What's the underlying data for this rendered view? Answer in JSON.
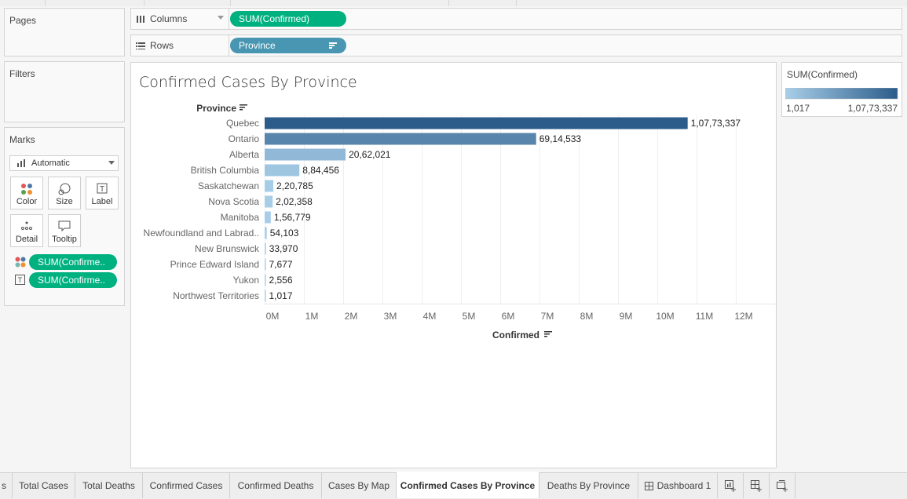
{
  "sidebar": {
    "pages_title": "Pages",
    "filters_title": "Filters",
    "marks_title": "Marks",
    "mark_type": "Automatic",
    "mark_buttons": {
      "color": "Color",
      "size": "Size",
      "label": "Label",
      "detail": "Detail",
      "tooltip": "Tooltip"
    },
    "mark_pills": [
      "SUM(Confirme..",
      "SUM(Confirme.."
    ]
  },
  "shelves": {
    "columns_label": "Columns",
    "columns_pill": "SUM(Confirmed)",
    "rows_label": "Rows",
    "rows_pill": "Province"
  },
  "view": {
    "title": "Confirmed Cases By Province"
  },
  "legend": {
    "title": "SUM(Confirmed)",
    "min_label": "1,017",
    "max_label": "1,07,73,337",
    "color_low": "#a9cfe9",
    "color_high": "#2b5c8a"
  },
  "chart_data": {
    "type": "bar",
    "orientation": "horizontal",
    "row_header": "Province",
    "xlabel": "Confirmed",
    "xlim": [
      0,
      12800000
    ],
    "x_ticks": [
      "0M",
      "1M",
      "2M",
      "3M",
      "4M",
      "5M",
      "6M",
      "7M",
      "8M",
      "9M",
      "10M",
      "11M",
      "12M"
    ],
    "categories": [
      "Quebec",
      "Ontario",
      "Alberta",
      "British Columbia",
      "Saskatchewan",
      "Nova Scotia",
      "Manitoba",
      "Newfoundland and Labrad..",
      "New Brunswick",
      "Prince Edward Island",
      "Yukon",
      "Northwest Territories"
    ],
    "values": [
      10773337,
      6914533,
      2062021,
      884456,
      220785,
      202358,
      156779,
      54103,
      33970,
      7677,
      2556,
      1017
    ],
    "value_labels": [
      "1,07,73,337",
      "69,14,533",
      "20,62,021",
      "8,84,456",
      "2,20,785",
      "2,02,358",
      "1,56,779",
      "54,103",
      "33,970",
      "7,677",
      "2,556",
      "1,017"
    ],
    "color_scale": [
      "#a9cfe9",
      "#2b5c8a"
    ],
    "grid": true
  },
  "tabs": [
    {
      "label": "s",
      "active": false
    },
    {
      "label": "Total Cases",
      "active": false
    },
    {
      "label": "Total Deaths",
      "active": false
    },
    {
      "label": "Confirmed Cases",
      "active": false
    },
    {
      "label": "Confirmed Deaths",
      "active": false
    },
    {
      "label": "Cases By Map",
      "active": false
    },
    {
      "label": "Confirmed Cases By Province",
      "active": true
    },
    {
      "label": "Deaths By Province",
      "active": false
    },
    {
      "label": "Dashboard 1",
      "active": false
    }
  ]
}
